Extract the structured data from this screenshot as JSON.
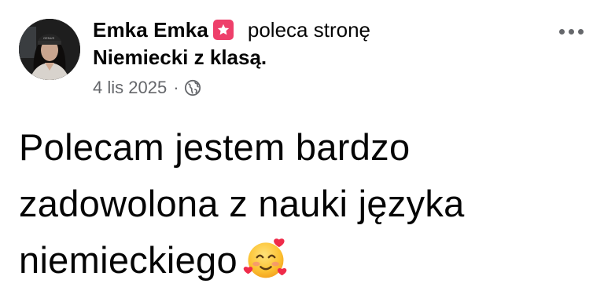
{
  "post": {
    "author_name": "Emka Emka",
    "action_text": "poleca stronę",
    "page_name": "Niemiecki z klasą.",
    "date": "4 lis 2025",
    "separator": "·",
    "privacy_icon": "globe-icon",
    "recommend_badge_icon": "star-badge-icon",
    "more_icon": "more-options-icon",
    "body_text": "Polecam jestem bardzo zadowolona z nauki języka niemieckiego",
    "body_emoji": "smiling-face-with-hearts-icon"
  },
  "colors": {
    "badge": "#ee3f6a",
    "meta_text": "#65676b",
    "text": "#050505",
    "background": "#ffffff"
  }
}
